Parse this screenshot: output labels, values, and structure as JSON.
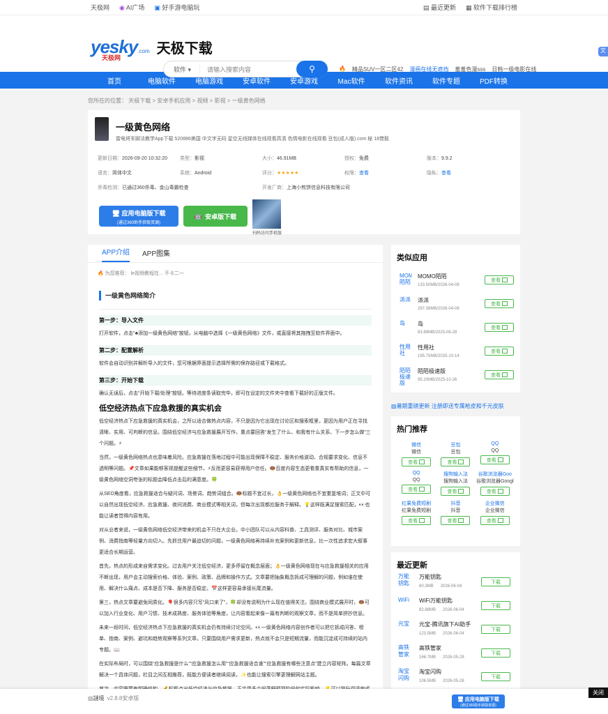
{
  "topbar": {
    "site": "天极网",
    "ai": "AI广场",
    "games": "好手游电脑玩",
    "latest": "最近更新",
    "rank": "软件下载排行榜"
  },
  "header": {
    "logo_text": "yesky",
    "logo_sub": "天极网",
    "logo_com": ".com",
    "title": "天极下载",
    "search_category": "软件",
    "search_placeholder": "请输入搜索内容",
    "hot": [
      "精品SUV一区二区42",
      "漫画在线无遮挡",
      "羞羞色漫sss",
      "日韩一级电影在线"
    ]
  },
  "nav": [
    "首页",
    "电脑软件",
    "电脑游戏",
    "安卓软件",
    "安卓游戏",
    "Mac软件",
    "软件资讯",
    "软件专题",
    "PDF转换"
  ],
  "breadcrumb": "您所在的位置： 天极下载 > 安卓手机应用 > 视频 > 影视 > 一级黄色网络",
  "app": {
    "title": "一级黄色网络",
    "desc": "雷电将军脚法教学App下载 520886美国 中文字无码 星空无线媒体在线观看高清 色情电影在线观看 豆包(成人版).com 秘 18憬毅",
    "meta": [
      {
        "k": "更新日期：",
        "v": "2026-09-20 10:32:20"
      },
      {
        "k": "类型：",
        "v": "影视"
      },
      {
        "k": "大小：",
        "v": "46.91MB"
      },
      {
        "k": "授权：",
        "v": "免费"
      },
      {
        "k": "版本：",
        "v": "9.9.2"
      },
      {
        "k": "语言：",
        "v": "简体中文"
      },
      {
        "k": "系统：",
        "v": "Android"
      },
      {
        "k": "评分：",
        "v": "★★★★★"
      },
      {
        "k": "权限：",
        "v": "查看"
      },
      {
        "k": "隐私：",
        "v": "查看"
      },
      {
        "k": "杀毒检测：",
        "v": "已通过360杀毒、金山毒霸检查"
      },
      {
        "k": "",
        "v": ""
      },
      {
        "k": "开发厂商：",
        "v": "上海小煎饼信息科技有限公司"
      },
      {
        "k": "",
        "v": ""
      },
      {
        "k": "",
        "v": ""
      }
    ],
    "pc_btn": "应用电脑版下载",
    "pc_btn_sub": "(通过360助手获取资源)",
    "android_btn": "安卓版下载",
    "qr_text": "扫码访问手机版"
  },
  "tabs": [
    "APP介绍",
    "APP图集"
  ],
  "recommend": "为您推荐： le视频教程在... 不卡二一",
  "intro_title": "一级黄色网络简介",
  "content": [
    {
      "t": "step",
      "v": "第一步：导入文件"
    },
    {
      "t": "p",
      "v": "打开软件，点击\"♣添加一级黄色网络\"按钮，从电脑中选择《一级黄色网络》文件，或直接将其拖拽至软件界面中。"
    },
    {
      "t": "step",
      "v": "第二步：配置解析"
    },
    {
      "t": "p",
      "v": "软件会自动识别并解析导入的文件，您可根据界面提示选择所需的保存路径或下载格式。"
    },
    {
      "t": "step",
      "v": "第三步：开始下载"
    },
    {
      "t": "p",
      "v": "确认无误后，点击\"开始下载/处理\"按钮。等待进度条读取完毕，即可在设定的文件夹中查看下载好的正版文件。"
    },
    {
      "t": "h2",
      "v": "低空经济热点下应急救援的真实机会"
    },
    {
      "t": "p",
      "v": "低空经济热点下应急救援的真实机会，之所以适合做热点内容，不只是因为它出现在讨论区和搜索框里，更因为用户正在寻找清晰、实用、可判断的信息。围绕低空经济与应急救援展开写作，重点要回答“发生了什么、和我有什么关系、下一步怎么做”三个问题。⚡"
    },
    {
      "t": "p",
      "v": "当然，一级黄色网络热点也意味着风险。应急救援在落地过程中可能出现保障不稳定、服务价格波动、合规要求变化、信息不透明等问题。📌文章如果能够客观提醒这些细节，⚡反而更容易获得用户信任。🍩百度内容生态更看重真实有帮助的信息，一级黄色网络空洞夸张的标题会降低点击后的满意度。🍀"
    },
    {
      "t": "p",
      "v": "从SEO角度看，应急救援适合与疑问词、场景词、趋势词组合。🍩标题不宜过长，👌一级黄色网络也不宜重复堆词；正文中可以自然出现低空经济、应急救援、夜间消费、商业模式等相关词，但每次出现都应服务于解释。💡这样既满足搜索匹配，👀也能让读者觉得内容有用。"
    },
    {
      "t": "p",
      "v": "对从业者来说，一级黄色网络低空经济带来的机会不只在大企业。中小团队可以从内容科普、工具测评、服务对比、城市案例、消费指南等轻量方向切入。先抓住用户最迫切的问题，一级黄色网络再持续补充案例和更新信息，比一次性追求宏大叙事更适合长期运营。"
    },
    {
      "t": "p",
      "v": "首先，热点的形成来自需求变化。过去用户关注低空经济，更多停留在概念层面；👌一级黄色网络现在与应急救援相关的应用不断出现，用户会主动搜索价格、体验、案例、政策、品牌和操作方式。文章要把抽象概念拆成可理解的问题，例如谁在使用、解决什么痛点、成本是否下降、服务是否稳定。📅这样更容易承接长尾流量。"
    },
    {
      "t": "p",
      "v": "第三，热点文章要避免同质化。🎈很多内容只写“风口来了”，🍀却没有说明为什么现在值得关注。围绕商业模式展开时，🍩可以加入行业变化、用户习惯、技术成熟度、服务体验等角度，让内容看起来像一篇有判断的观察文章，而不是简单拼抄信息。"
    },
    {
      "t": "p",
      "v": "未来一段时间，低空经济热点下应急救援的真实机会仍有持续讨论空间。👀一级黄色网络内容创作者可以把它拆成问答、榜单、指南、案例、避坑和趋势观察等系列文章。只要围绕用户需求更新，热点就不会只是短期流量，而能沉淀成可持续的站内专题。📖"
    },
    {
      "t": "p",
      "v": "在实际布局时，可以围绕“应急救援是什么”“应急救援怎么用”“应急救援适合谁”“应急救援有哪些注意点”建立内容矩阵。每篇文章解决一个具体问题，栏目之间互相推荐，既能方便读者继续阅读，✨也能让搜索引擎更理解网站主题。"
    },
    {
      "t": "p",
      "v": "其次，内容需要有明确结构。💰标题点出低空经济与应急救援，正文用多个段落解释现阶段的实际影响，💡可以提升阅读完成度，比如企业关心效率和成本，普通用户关心便利和安全，本地商家关心引流和转化。🍩不同人群的需求被分层表达，文章就不会显得空泛。"
    }
  ],
  "similar_title": "类似应用",
  "similar": [
    {
      "icon": "MOMO陌陌",
      "name": "MOMO陌陌",
      "size": "133.50MB/2026-04-08"
    },
    {
      "icon": "派派",
      "name": "派派",
      "size": "297.39MB/2026-04-08"
    },
    {
      "icon": "岛",
      "name": "岛",
      "size": "83.89MB/2025-08-28"
    },
    {
      "icon": "性用社",
      "name": "性用社",
      "size": "195.75MB/2025-10-14"
    },
    {
      "icon": "陌陌极速版",
      "name": "陌陌极速版",
      "size": "95.20MB/2025-10-26"
    }
  ],
  "view_btn": "查看",
  "banner": "暑期重磅更新 注册即送专属枪皮和千元皮肤",
  "hot_title": "热门推荐",
  "hot_apps": [
    {
      "icon": "微信",
      "name": "微信"
    },
    {
      "icon": "豆包",
      "name": "豆包"
    },
    {
      "icon": "QQ",
      "name": "QQ"
    },
    {
      "icon": "QQ",
      "name": "QQ"
    },
    {
      "icon": "搜狗输入法",
      "name": "搜狗输入法"
    },
    {
      "icon": "谷歌浏览器Goo",
      "name": "谷歌浏览器Googl"
    },
    {
      "icon": "红果免费短剧",
      "name": "红果免费短剧"
    },
    {
      "icon": "抖音",
      "name": "抖音"
    },
    {
      "icon": "企业微信",
      "name": "企业微信"
    }
  ],
  "recent_title": "最近更新",
  "recent": [
    {
      "icon": "万能钥匙",
      "name": "万能钥匙",
      "size": "60.3MB",
      "date": "2026-06-04"
    },
    {
      "icon": "WiFi",
      "name": "WiFi万能钥匙",
      "size": "82.88MB",
      "date": "2026-06-04"
    },
    {
      "icon": "元宝",
      "name": "元宝-腾讯旗下AI助手",
      "size": "123.5MB",
      "date": "2026-06-04"
    },
    {
      "icon": "高铁管家",
      "name": "高铁管家",
      "size": "166.7MB",
      "date": "2026-05-28"
    },
    {
      "icon": "淘宝闪购",
      "name": "淘宝闪购",
      "size": "106.5MB",
      "date": "2026-05-28"
    }
  ],
  "download_btn": "下载",
  "bottom": {
    "app": "謎境",
    "version": "v2.8.8安卓版",
    "btn": "应用电脑版下载",
    "btn_sub": "(通过360助手获取资源)",
    "close": "关闭"
  }
}
